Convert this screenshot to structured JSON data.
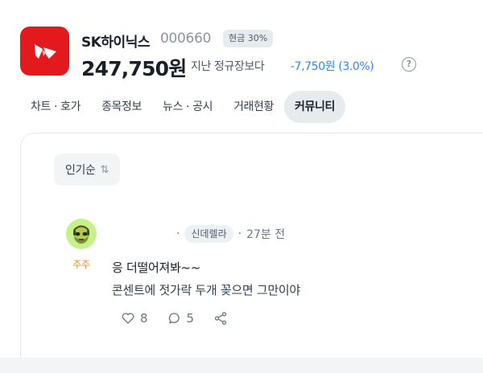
{
  "stock": {
    "name": "SK하이닉스",
    "code": "000660",
    "badge": "현금 30%",
    "price": "247,750원",
    "compare_label": "지난 정규장보다",
    "change": "-7,750원 (3.0%)",
    "info_symbol": "?"
  },
  "tabs": [
    {
      "label": "차트 · 호가",
      "active": false
    },
    {
      "label": "종목정보",
      "active": false
    },
    {
      "label": "뉴스 · 공시",
      "active": false
    },
    {
      "label": "거래현황",
      "active": false
    },
    {
      "label": "커뮤니티",
      "active": true
    }
  ],
  "sort": {
    "label": "인기순",
    "icon": "sort-arrows-icon"
  },
  "post": {
    "nickname": "주주",
    "separator_1": "·",
    "tag": "신데렐라",
    "separator_2": "·",
    "time": "27분 전",
    "title": "응 더떨어져봐~~",
    "body": "콘센트에 젓가락 두개 꽂으면 그만이야",
    "likes": "8",
    "comments": "5"
  },
  "colors": {
    "brand_red": "#e3191d",
    "down_blue": "#3182f6",
    "nickname_orange": "#f08a24",
    "avatar_green": "#c4f18a"
  }
}
